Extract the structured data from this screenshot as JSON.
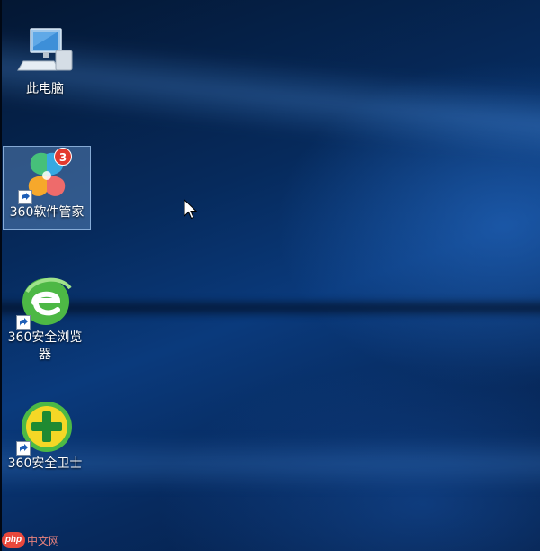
{
  "desktop": {
    "icons": [
      {
        "label": "此电脑",
        "icon": "computer-icon",
        "shortcut": false,
        "selected": false
      },
      {
        "label": "360软件管家",
        "icon": "360-software-manager-icon",
        "shortcut": true,
        "selected": true,
        "badge": "3"
      },
      {
        "label": "360安全浏览器",
        "icon": "360-browser-icon",
        "shortcut": true,
        "selected": false
      },
      {
        "label": "360安全卫士",
        "icon": "360-security-guard-icon",
        "shortcut": true,
        "selected": false
      }
    ]
  },
  "watermark": {
    "logo_text": "php",
    "text": "中文网"
  },
  "colors": {
    "wallpaper_dark": "#041733",
    "wallpaper_light": "#0a3a7c",
    "badge": "#e33a2e",
    "watermark": "#e9483c"
  }
}
